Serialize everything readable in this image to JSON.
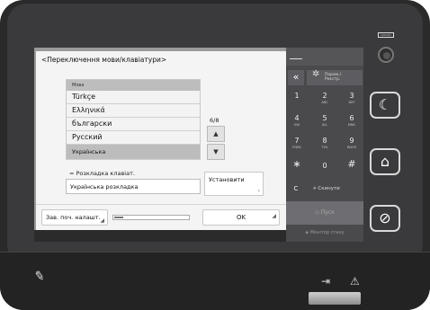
{
  "dialog": {
    "title": "<Переключення мови/клавіатури>",
    "list_header": "Мова",
    "languages": [
      "Türkçe",
      "Ελληνικά",
      "български",
      "Русский",
      "Українська"
    ],
    "page_indicator": "6/8",
    "scroll_up_symbol": "▲",
    "scroll_down_symbol": "▼",
    "keyboard_label": "= Розкладка клавіат.",
    "keyboard_value": "Українська розкладка",
    "set_button": "Установити",
    "defaults_button": "Зав. поч. налашт.",
    "ok_button": "OK",
    "progress_fraction": 0.12
  },
  "keypad": {
    "back_symbol": "«",
    "param_line1": "Парам./",
    "param_line2": "Реєстр.",
    "gear_symbol": "✲",
    "rows": [
      [
        {
          "d": "1",
          "l": ""
        },
        {
          "d": "2",
          "l": "ABC"
        },
        {
          "d": "3",
          "l": "DEF"
        }
      ],
      [
        {
          "d": "4",
          "l": "GHI"
        },
        {
          "d": "5",
          "l": "JKL"
        },
        {
          "d": "6",
          "l": "MNO"
        }
      ],
      [
        {
          "d": "7",
          "l": "PQRS"
        },
        {
          "d": "8",
          "l": "TUV"
        },
        {
          "d": "9",
          "l": "WXYZ"
        }
      ],
      [
        {
          "d": "∗",
          "l": ""
        },
        {
          "d": "0",
          "l": ""
        },
        {
          "d": "#",
          "l": ""
        }
      ]
    ],
    "clear_key": "C",
    "reset_label": "⟡ Скинути",
    "start_label": "◇ Пуск",
    "monitor_label": "◈ Монітор стану"
  },
  "device": {
    "battery_label": "▭▭▭",
    "sleep_symbol": "☾",
    "home_symbol": "⌂",
    "stop_symbol": "⊘",
    "pencil_symbol": "✎",
    "data_symbol": "⇥",
    "warning_symbol": "⚠"
  }
}
